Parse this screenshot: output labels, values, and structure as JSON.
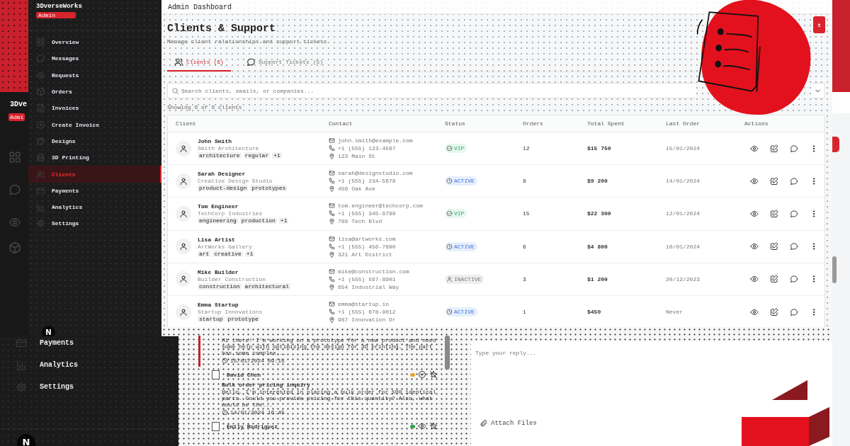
{
  "back_sidebar": {
    "brand": "3Dve",
    "badge": "Admi"
  },
  "sidebar": {
    "brand": "3DverseWorks",
    "badge": "Admin",
    "items": [
      {
        "label": "Overview",
        "selected": false
      },
      {
        "label": "Messages",
        "selected": false
      },
      {
        "label": "Requests",
        "selected": false
      },
      {
        "label": "Orders",
        "selected": false
      },
      {
        "label": "Invoices",
        "selected": false
      },
      {
        "label": "Create Invoice",
        "selected": false
      },
      {
        "label": "Designs",
        "selected": false
      },
      {
        "label": "3D Printing",
        "selected": false
      },
      {
        "label": "Clients",
        "selected": true
      },
      {
        "label": "Payments",
        "selected": false
      },
      {
        "label": "Analytics",
        "selected": false
      },
      {
        "label": "Settings",
        "selected": false
      }
    ]
  },
  "dev_badges": [
    "N",
    "N"
  ],
  "lower_sidebar": {
    "items": [
      {
        "label": "Payments"
      },
      {
        "label": "Analytics"
      },
      {
        "label": "Settings"
      }
    ]
  },
  "header": {
    "title": "Admin Dashboard"
  },
  "page": {
    "title": "Clients & Support",
    "subtitle": "Manage client relationships and support tickets",
    "action_button": "t"
  },
  "tabs": [
    {
      "label": "Clients (6)",
      "selected": true
    },
    {
      "label": "Support Tickets (5)",
      "selected": false
    }
  ],
  "search": {
    "placeholder": "Search clients, emails, or companies..."
  },
  "result_count": "Showing 6 of 6 clients",
  "table": {
    "columns": [
      "Client",
      "Contact",
      "Status",
      "Orders",
      "Total Spent",
      "Last Order",
      "Actions"
    ],
    "rows": [
      {
        "name": "John Smith",
        "company": "Smith Architecture",
        "tags": [
          "architecture",
          "regular",
          "+1"
        ],
        "email": "john.smith@example.com",
        "phone": "+1 (555) 123-4567",
        "address": "123 Main St",
        "status": {
          "label": "VIP",
          "kind": "vip"
        },
        "orders": "12",
        "total": "$15 750",
        "last_order": "15/01/2024"
      },
      {
        "name": "Sarah Designer",
        "company": "Creative Design Studio",
        "tags": [
          "product-design",
          "prototypes"
        ],
        "email": "sarah@designstudio.com",
        "phone": "+1 (555) 234-5678",
        "address": "456 Oak Ave",
        "status": {
          "label": "ACTIVE",
          "kind": "active"
        },
        "orders": "8",
        "total": "$9 200",
        "last_order": "14/01/2024"
      },
      {
        "name": "Tom Engineer",
        "company": "TechCorp Industries",
        "tags": [
          "engineering",
          "production",
          "+1"
        ],
        "email": "tom.engineer@techcorp.com",
        "phone": "+1 (555) 345-6789",
        "address": "789 Tech Blvd",
        "status": {
          "label": "VIP",
          "kind": "vip"
        },
        "orders": "15",
        "total": "$22 300",
        "last_order": "12/01/2024"
      },
      {
        "name": "Lisa Artist",
        "company": "ArtWorks Gallery",
        "tags": [
          "art",
          "creative",
          "+1"
        ],
        "email": "lisa@artworks.com",
        "phone": "+1 (555) 456-7890",
        "address": "321 Art District",
        "status": {
          "label": "ACTIVE",
          "kind": "active"
        },
        "orders": "6",
        "total": "$4 800",
        "last_order": "10/01/2024"
      },
      {
        "name": "Mike Builder",
        "company": "Builder Construction",
        "tags": [
          "construction",
          "architectural"
        ],
        "email": "mike@construction.com",
        "phone": "+1 (555) 567-8901",
        "address": "654 Industrial Way",
        "status": {
          "label": "INACTIVE",
          "kind": "inactive"
        },
        "orders": "3",
        "total": "$1 200",
        "last_order": "20/12/2023"
      },
      {
        "name": "Emma Startup",
        "company": "Startup Innovations",
        "tags": [
          "startup",
          "prototype"
        ],
        "email": "emma@startup.io",
        "phone": "+1 (555) 678-9012",
        "address": "987 Innovation Dr",
        "status": {
          "label": "ACTIVE",
          "kind": "active"
        },
        "orders": "1",
        "total": "$450",
        "last_order": "Never"
      }
    ]
  },
  "tickets": {
    "items": [
      {
        "selected": true,
        "message": "Hi there! I'm working on a prototype for a new product and need some help with optimizing the design for 3D printing. The part has some complex...",
        "time": "15/01/2024 09:15"
      },
      {
        "selected": false,
        "name": "David Chen",
        "color": "#e8a33a",
        "subject": "Bulk order pricing inquiry",
        "message": "Hello, I'm interested in placing a bulk order for 500 identical parts. Could you provide pricing for this quantity? Also, what would be the...",
        "time": "14/01/2024 16:45"
      },
      {
        "selected": false,
        "name": "Emily Rodriguez",
        "color": "#2ea84a"
      }
    ]
  },
  "reply": {
    "placeholder": "Type your reply...",
    "attach_button": "Attach Files"
  }
}
